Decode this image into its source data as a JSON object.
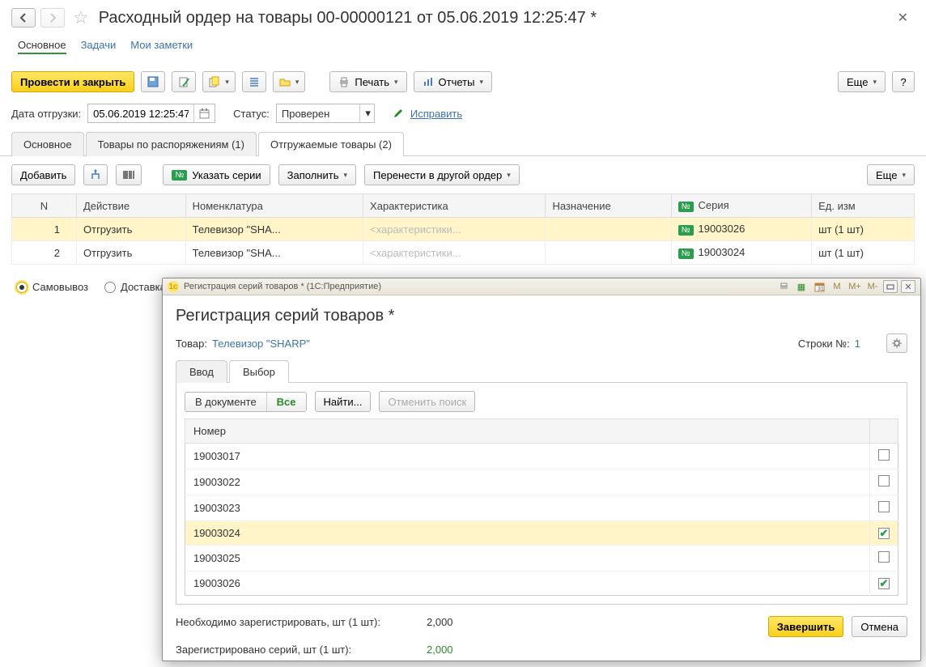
{
  "header": {
    "title": "Расходный ордер на товары 00-00000121 от 05.06.2019 12:25:47 *"
  },
  "subnav": {
    "main": "Основное",
    "tasks": "Задачи",
    "notes": "Мои заметки"
  },
  "toolbar": {
    "post_close": "Провести и закрыть",
    "print": "Печать",
    "reports": "Отчеты",
    "more": "Еще",
    "help": "?"
  },
  "fields": {
    "ship_date_label": "Дата отгрузки:",
    "ship_date_value": "05.06.2019 12:25:47",
    "status_label": "Статус:",
    "status_value": "Проверен",
    "fix_label": "Исправить"
  },
  "tabs": {
    "t1": "Основное",
    "t2": "Товары по распоряжениям (1)",
    "t3": "Отгружаемые товары (2)"
  },
  "subtoolbar": {
    "add": "Добавить",
    "set_series": "Указать серии",
    "fill": "Заполнить",
    "move": "Перенести в другой ордер",
    "more": "Еще"
  },
  "columns": {
    "n": "N",
    "action": "Действие",
    "nomen": "Номенклатура",
    "char": "Характеристика",
    "purpose": "Назначение",
    "series": "Серия",
    "uom": "Ед. изм"
  },
  "rows": [
    {
      "n": "1",
      "action": "Отгрузить",
      "nomen": "Телевизор \"SHA...",
      "char": "<характеристики...",
      "series": "19003026",
      "uom": "шт (1 шт)"
    },
    {
      "n": "2",
      "action": "Отгрузить",
      "nomen": "Телевизор \"SHA...",
      "char": "<характеристики...",
      "series": "19003024",
      "uom": "шт (1 шт)"
    }
  ],
  "radios": {
    "pickup": "Самовывоз",
    "delivery": "Доставка"
  },
  "modal": {
    "wintitle": "Регистрация серий товаров *  (1С:Предприятие)",
    "title": "Регистрация серий товаров *",
    "goods_label": "Товар:",
    "goods_value": "Телевизор \"SHARP\"",
    "lines_label": "Строки №:",
    "lines_value": "1",
    "tab_input": "Ввод",
    "tab_select": "Выбор",
    "seg_doc": "В документе",
    "seg_all": "Все",
    "find": "Найти...",
    "cancel_search": "Отменить поиск",
    "col_number": "Номер",
    "serials": [
      {
        "num": "19003017",
        "checked": false
      },
      {
        "num": "19003022",
        "checked": false
      },
      {
        "num": "19003023",
        "checked": false
      },
      {
        "num": "19003024",
        "checked": true,
        "sel": true
      },
      {
        "num": "19003025",
        "checked": false
      },
      {
        "num": "19003026",
        "checked": true
      }
    ],
    "need_label": "Необходимо зарегистрировать, шт (1 шт):",
    "need_value": "2,000",
    "reg_label": "Зарегистрировано серий, шт (1 шт):",
    "reg_value": "2,000",
    "finish": "Завершить",
    "cancel": "Отмена",
    "m": "M",
    "mp": "M+",
    "mm": "M-"
  }
}
